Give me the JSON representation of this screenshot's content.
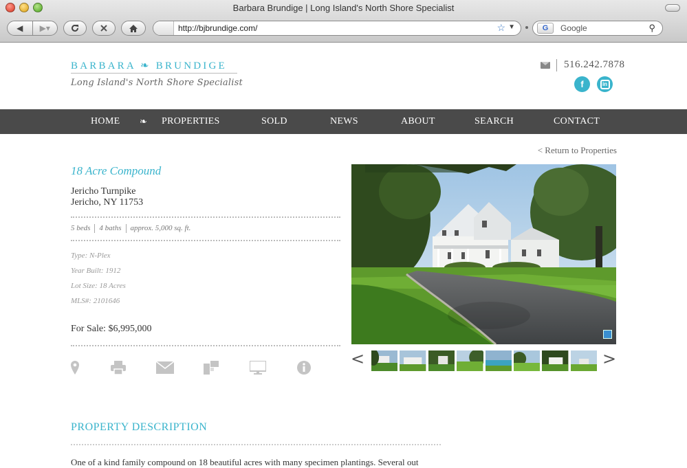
{
  "browser": {
    "window_title": "Barbara Brundige | Long Island's North Shore Specialist",
    "url": "http://bjbrundige.com/",
    "search_placeholder": "Google"
  },
  "site": {
    "logo_top": "BARBARA ❧ BRUNDIGE",
    "logo_tagline": "Long Island's North Shore Specialist",
    "phone": "516.242.7878",
    "nav": [
      "HOME",
      "PROPERTIES",
      "SOLD",
      "NEWS",
      "ABOUT",
      "SEARCH",
      "CONTACT"
    ],
    "accent_color": "#3ab4cc",
    "nav_bg": "#4a4a4a"
  },
  "listing": {
    "return_link": "< Return to Properties",
    "title": "18 Acre Compound",
    "address_line1": "Jericho Turnpike",
    "address_line2": "Jericho, NY 11753",
    "beds": "5 beds",
    "baths": "4 baths",
    "size": "approx. 5,000 sq. ft.",
    "type": "Type: N-Plex",
    "year_built": "Year Built: 1912",
    "lot_size": "Lot Size: 18 Acres",
    "mls": "MLS#: 2101646",
    "price": "For Sale: $6,995,000",
    "action_icons": [
      "map-pin-icon",
      "print-icon",
      "email-icon",
      "floorplan-icon",
      "virtual-tour-icon",
      "info-icon"
    ],
    "gallery_prev": "<",
    "gallery_next": ">",
    "thumbnail_count": 8,
    "description_heading": "PROPERTY DESCRIPTION",
    "description_text": "One of a kind family compound on 18 beautiful acres with many specimen plantings. Several out"
  }
}
